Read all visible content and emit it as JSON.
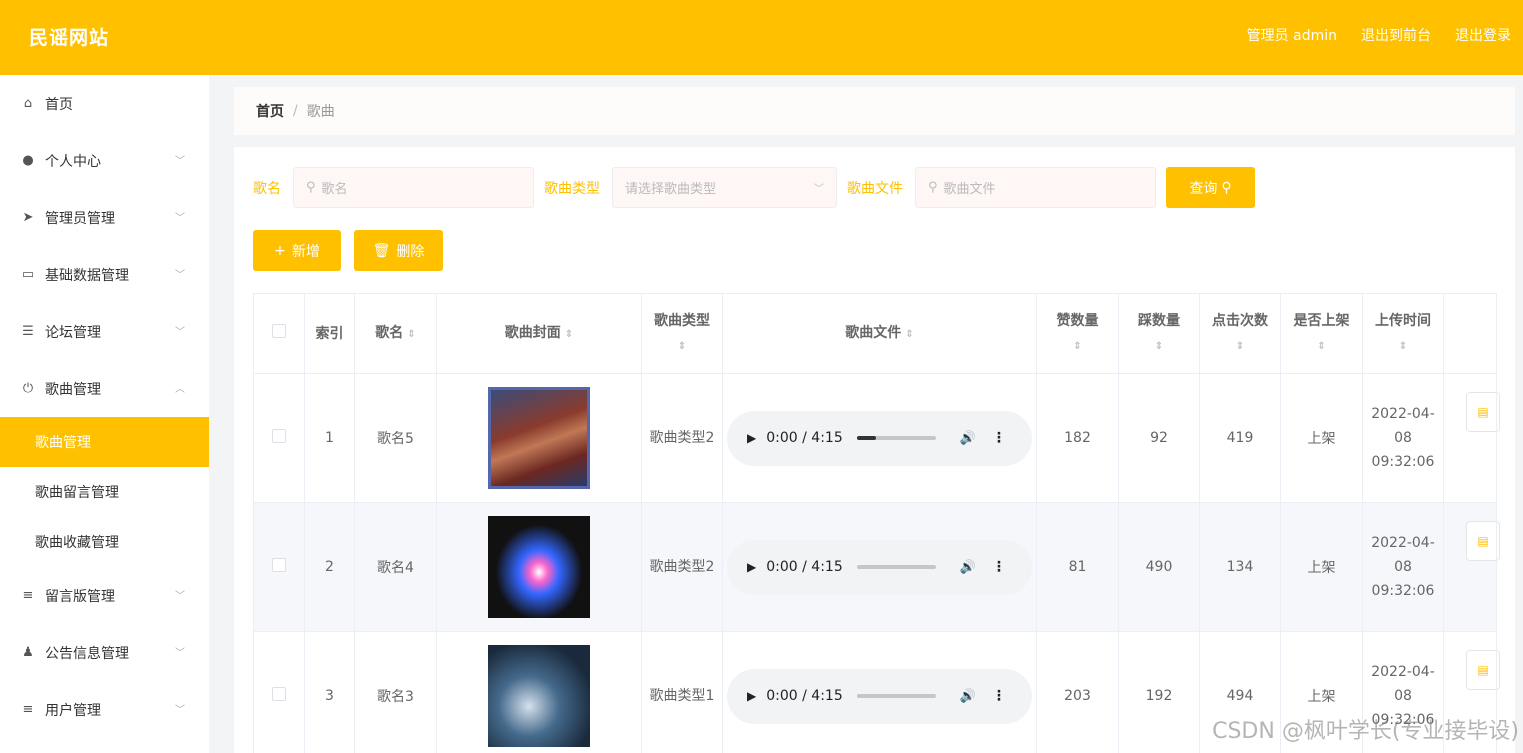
{
  "header": {
    "brand": "民谣网站",
    "admin_label": "管理员 admin",
    "exit_front": "退出到前台",
    "logout": "退出登录"
  },
  "sidebar": {
    "items": [
      {
        "label": "首页",
        "icon": "home-icon"
      },
      {
        "label": "个人中心",
        "icon": "user-icon"
      },
      {
        "label": "管理员管理",
        "icon": "send-icon"
      },
      {
        "label": "基础数据管理",
        "icon": "message-icon"
      },
      {
        "label": "论坛管理",
        "icon": "sliders-icon"
      },
      {
        "label": "歌曲管理",
        "icon": "power-icon"
      }
    ],
    "subitems": [
      {
        "label": "歌曲管理",
        "active": true
      },
      {
        "label": "歌曲留言管理"
      },
      {
        "label": "歌曲收藏管理"
      }
    ],
    "items_after": [
      {
        "label": "留言版管理",
        "icon": "list-icon"
      },
      {
        "label": "公告信息管理",
        "icon": "person-icon"
      },
      {
        "label": "用户管理",
        "icon": "menu-icon"
      }
    ]
  },
  "breadcrumb": {
    "home": "首页",
    "sep": "/",
    "current": "歌曲"
  },
  "search": {
    "name_label": "歌名",
    "name_placeholder": "歌名",
    "type_label": "歌曲类型",
    "type_placeholder": "请选择歌曲类型",
    "file_label": "歌曲文件",
    "file_placeholder": "歌曲文件",
    "query_button": "查询"
  },
  "actions": {
    "add": "新增",
    "delete": "删除"
  },
  "table": {
    "headers": {
      "index": "索引",
      "name": "歌名",
      "cover": "歌曲封面",
      "type": "歌曲类型",
      "file": "歌曲文件",
      "likes": "赞数量",
      "dislikes": "踩数量",
      "clicks": "点击次数",
      "listed": "是否上架",
      "upload_time": "上传时间"
    },
    "rows": [
      {
        "index": "1",
        "name": "歌名5",
        "type": "歌曲类型2",
        "audio_time": "0:00 / 4:15",
        "audio_buffered": 0.25,
        "likes": "182",
        "dislikes": "92",
        "clicks": "419",
        "listed": "上架",
        "upload_time": "2022-04-08 09:32:06"
      },
      {
        "index": "2",
        "name": "歌名4",
        "type": "歌曲类型2",
        "audio_time": "0:00 / 4:15",
        "audio_buffered": 0,
        "likes": "81",
        "dislikes": "490",
        "clicks": "134",
        "listed": "上架",
        "upload_time": "2022-04-08 09:32:06"
      },
      {
        "index": "3",
        "name": "歌名3",
        "type": "歌曲类型1",
        "audio_time": "0:00 / 4:15",
        "audio_buffered": 0,
        "likes": "203",
        "dislikes": "192",
        "clicks": "494",
        "listed": "上架",
        "upload_time": "2022-04-08 09:32:06"
      }
    ]
  },
  "watermark": "CSDN @枫叶学长(专业接毕设)",
  "colors": {
    "accent": "#ffc000",
    "row_alt": "#f5f7fa"
  }
}
